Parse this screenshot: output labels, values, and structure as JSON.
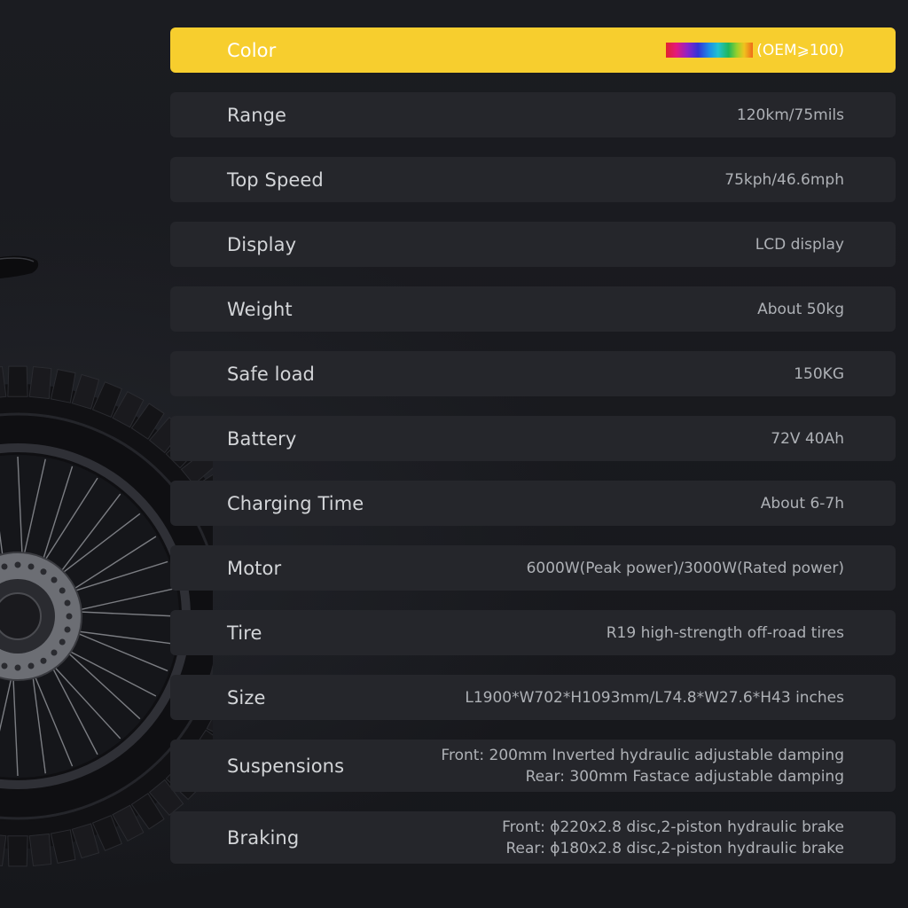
{
  "specs": [
    {
      "label": "Color",
      "value": "(OEM⩾100)",
      "highlight": true,
      "swatch": true
    },
    {
      "label": "Range",
      "value": "120km/75mils"
    },
    {
      "label": "Top Speed",
      "value": "75kph/46.6mph"
    },
    {
      "label": "Display",
      "value": "LCD display"
    },
    {
      "label": "Weight",
      "value": "About 50kg"
    },
    {
      "label": "Safe load",
      "value": "150KG"
    },
    {
      "label": "Battery",
      "value": "72V 40Ah"
    },
    {
      "label": "Charging Time",
      "value": "About 6-7h"
    },
    {
      "label": "Motor",
      "value": "6000W(Peak power)/3000W(Rated power)"
    },
    {
      "label": "Tire",
      "value": "R19 high-strength off-road tires"
    },
    {
      "label": "Size",
      "value": "L1900*W702*H1093mm/L74.8*W27.6*H43 inches"
    },
    {
      "label": "Suspensions",
      "value_lines": [
        "Front: 200mm Inverted hydraulic adjustable damping",
        "Rear: 300mm Fastace adjustable damping"
      ]
    },
    {
      "label": "Braking",
      "value_lines": [
        "Front: ϕ220x2.8 disc,2-piston hydraulic brake",
        "Rear: ϕ180x2.8 disc,2-piston hydraulic brake"
      ]
    }
  ],
  "colors": {
    "background": "#17181d",
    "row": "#25262b",
    "highlight": "#f7ce2e",
    "label_text": "#d3d5d8",
    "value_text": "#aeb1b6"
  },
  "illustration": {
    "icon": "dirt-bike-front-wheel-icon"
  }
}
